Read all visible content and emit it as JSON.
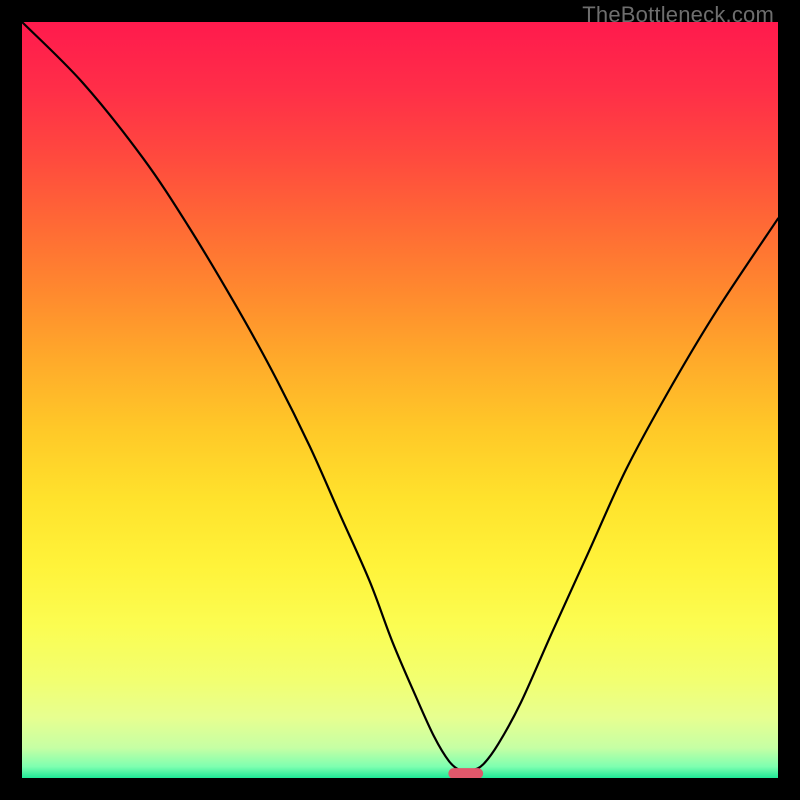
{
  "watermark": "TheBottleneck.com",
  "chart_data": {
    "type": "line",
    "title": "",
    "xlabel": "",
    "ylabel": "",
    "xlim": [
      0,
      100
    ],
    "ylim": [
      0,
      100
    ],
    "series": [
      {
        "name": "bottleneck-curve",
        "x": [
          0,
          8,
          16,
          22,
          28,
          33,
          38,
          42,
          46,
          49,
          52,
          54.5,
          56.5,
          58,
          59.5,
          61,
          63,
          66,
          70,
          75,
          80,
          86,
          92,
          100
        ],
        "y": [
          100,
          92,
          82,
          73,
          63,
          54,
          44,
          35,
          26,
          18,
          11,
          5.5,
          2.2,
          1.0,
          1.0,
          1.8,
          4.5,
          10,
          19,
          30,
          41,
          52,
          62,
          74
        ]
      }
    ],
    "marker": {
      "x_center": 58.7,
      "y": 0.6,
      "width": 4.6,
      "height": 1.4,
      "color": "#e0586b"
    },
    "gradient_stops": [
      {
        "offset": 0.0,
        "color": "#ff1a4d"
      },
      {
        "offset": 0.09,
        "color": "#ff2e48"
      },
      {
        "offset": 0.18,
        "color": "#ff4a3e"
      },
      {
        "offset": 0.27,
        "color": "#ff6a35"
      },
      {
        "offset": 0.36,
        "color": "#ff8a2e"
      },
      {
        "offset": 0.45,
        "color": "#ffab2a"
      },
      {
        "offset": 0.54,
        "color": "#ffc928"
      },
      {
        "offset": 0.63,
        "color": "#ffe22c"
      },
      {
        "offset": 0.72,
        "color": "#fff33a"
      },
      {
        "offset": 0.8,
        "color": "#fbfd52"
      },
      {
        "offset": 0.87,
        "color": "#f2ff70"
      },
      {
        "offset": 0.92,
        "color": "#e7ff90"
      },
      {
        "offset": 0.96,
        "color": "#c6ffa4"
      },
      {
        "offset": 0.985,
        "color": "#7effb0"
      },
      {
        "offset": 1.0,
        "color": "#1fe896"
      }
    ],
    "line_color": "#000000",
    "line_width": 2.2
  }
}
